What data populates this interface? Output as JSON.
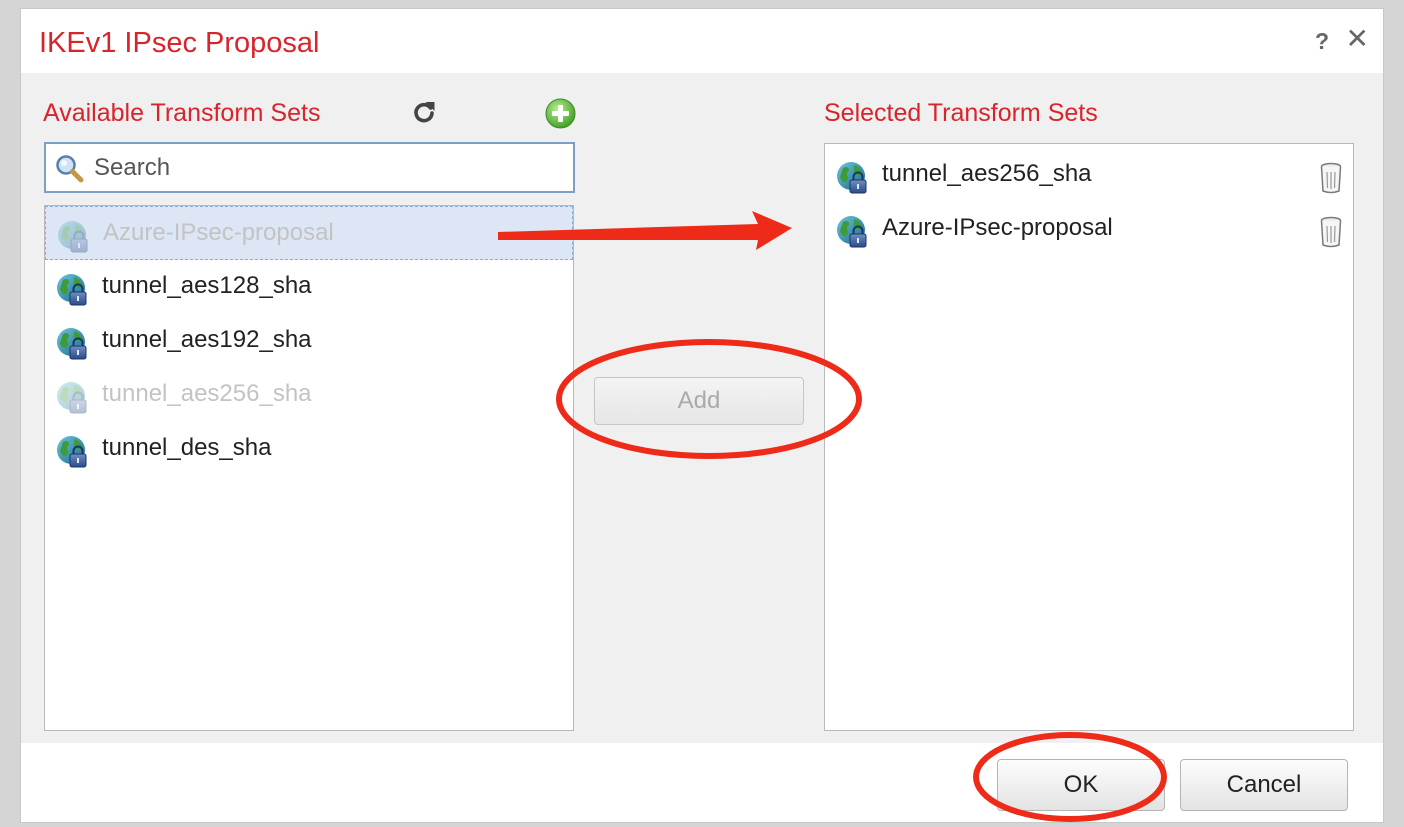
{
  "dialog": {
    "title": "IKEv1 IPsec Proposal",
    "help_glyph": "?",
    "close_glyph": "✕"
  },
  "available": {
    "label": "Available Transform Sets",
    "search_placeholder": "Search",
    "items": [
      {
        "label": "Azure-IPsec-proposal",
        "state": "selected-disabled"
      },
      {
        "label": "tunnel_aes128_sha",
        "state": "normal"
      },
      {
        "label": "tunnel_aes192_sha",
        "state": "normal"
      },
      {
        "label": "tunnel_aes256_sha",
        "state": "disabled"
      },
      {
        "label": "tunnel_des_sha",
        "state": "normal"
      }
    ]
  },
  "add_button_label": "Add",
  "selected": {
    "label": "Selected Transform Sets",
    "items": [
      {
        "label": "tunnel_aes256_sha"
      },
      {
        "label": "Azure-IPsec-proposal"
      }
    ]
  },
  "footer": {
    "ok_label": "OK",
    "cancel_label": "Cancel"
  },
  "colors": {
    "accent_red": "#d8242c",
    "annotation_red": "#ee2a18"
  }
}
